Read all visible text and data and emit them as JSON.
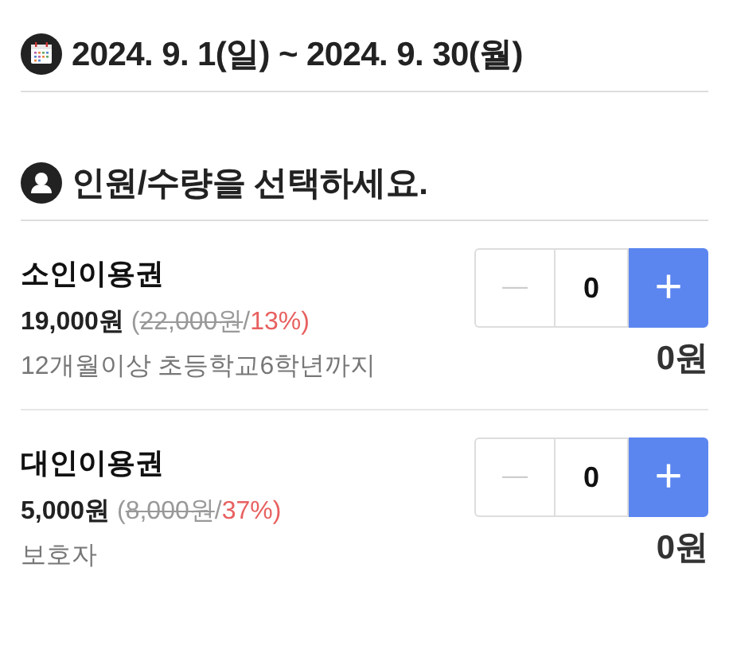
{
  "period": {
    "title": "2024. 9. 1(일) ~ 2024. 9. 30(월)"
  },
  "selection": {
    "title": "인원/수량을 선택하세요."
  },
  "tickets": [
    {
      "name": "소인이용권",
      "price": "19,000원",
      "original_open": "(",
      "original_price": "22,000원",
      "separator": "/",
      "discount": "13%)",
      "description": "12개월이상 초등학교6학년까지",
      "minus": "—",
      "plus": "+",
      "minus_disabled": true,
      "count": "0",
      "total": "0원"
    },
    {
      "name": "대인이용권",
      "price": "5,000원",
      "original_open": "(",
      "original_price": "8,000원",
      "separator": "/",
      "discount": "37%)",
      "description": "보호자",
      "minus": "—",
      "plus": "+",
      "minus_disabled": true,
      "count": "0",
      "total": "0원"
    }
  ]
}
